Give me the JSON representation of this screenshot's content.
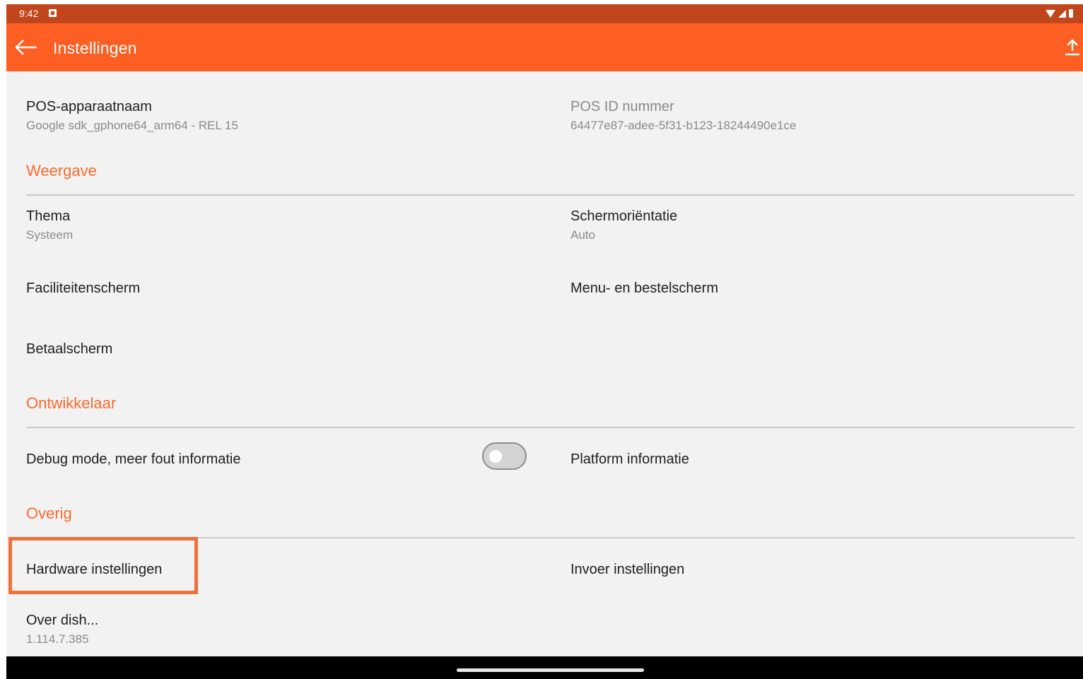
{
  "status_bar": {
    "time": "9:42",
    "icons": [
      "notification-icon",
      "wifi-icon",
      "signal-icon",
      "battery-icon"
    ]
  },
  "app_bar": {
    "title": "Instellingen",
    "back_icon": "arrow-left-icon",
    "action_icon": "upload-icon",
    "color": "#ff5f22"
  },
  "device_info": {
    "device_name_label": "POS-apparaatnaam",
    "device_name_value": "Google sdk_gphone64_arm64 - REL 15",
    "pos_id_label": "POS ID nummer",
    "pos_id_value": "64477e87-adee-5f31-b123-18244490e1ce"
  },
  "sections": {
    "display": {
      "header": "Weergave",
      "theme_label": "Thema",
      "theme_value": "Systeem",
      "orientation_label": "Schermoriëntatie",
      "orientation_value": "Auto",
      "facilities_label": "Faciliteitenscherm",
      "menu_order_label": "Menu- en bestelscherm",
      "payment_label": "Betaalscherm"
    },
    "developer": {
      "header": "Ontwikkelaar",
      "debug_label": "Debug mode, meer fout informatie",
      "debug_enabled": false,
      "platform_label": "Platform informatie"
    },
    "other": {
      "header": "Overig",
      "hardware_label": "Hardware instellingen",
      "input_label": "Invoer instellingen",
      "about_label": "Over dish...",
      "about_version": "1.114.7.385"
    }
  },
  "colors": {
    "accent": "#ff6a2e",
    "status_bar": "#c2461b",
    "highlight": "#f0703a"
  }
}
